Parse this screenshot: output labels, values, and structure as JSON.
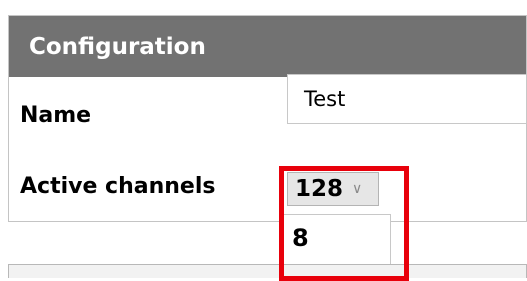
{
  "config": {
    "title": "Configuration",
    "name_label": "Name",
    "name_value": "Test",
    "channels_label": "Active channels",
    "channels_selected": "128",
    "channels_options": [
      "8",
      ""
    ],
    "chevron_icon": "chevron-down-icon"
  },
  "colors": {
    "header_bg": "#727272",
    "highlight": "#e8000b",
    "option_hover": "#cce8ff"
  }
}
